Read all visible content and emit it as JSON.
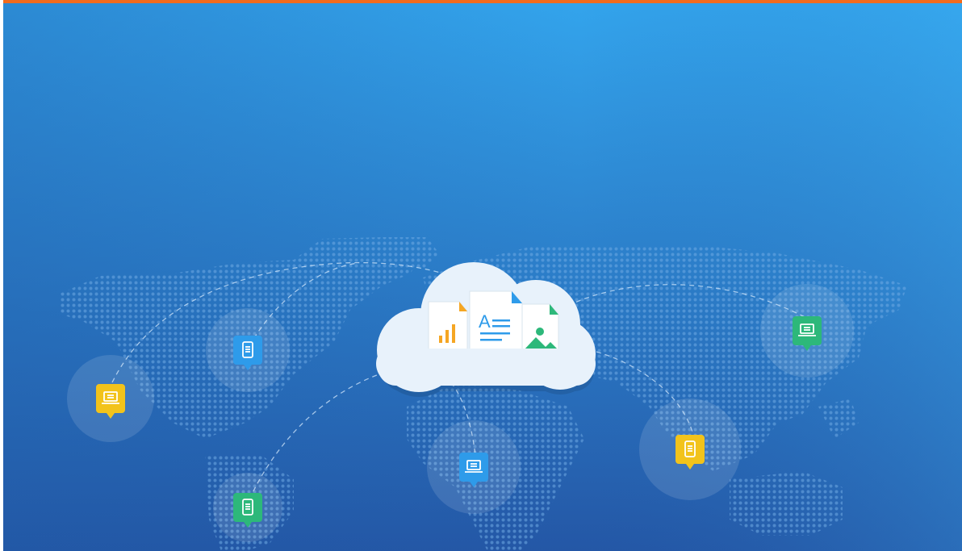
{
  "banner": {
    "accent_color": "#F26B1D",
    "gradient_top": "#33A4EC",
    "gradient_bottom": "#2457A6",
    "map_dot_color": "#6EA9E3",
    "cloud_color": "#E8F2FB",
    "cloud_files": [
      {
        "kind": "chart-file-icon",
        "accent": "#F5A623"
      },
      {
        "kind": "text-file-icon",
        "accent": "#2E9BEA"
      },
      {
        "kind": "image-file-icon",
        "accent": "#2DB87A"
      }
    ],
    "device_pins": [
      {
        "id": "pin-yellow-laptop-left",
        "device": "laptop-icon",
        "color": "#F2C31B"
      },
      {
        "id": "pin-blue-phone-left",
        "device": "phone-icon",
        "color": "#2E9BEA"
      },
      {
        "id": "pin-green-phone-bottom",
        "device": "phone-icon",
        "color": "#2DB87A"
      },
      {
        "id": "pin-blue-laptop-center",
        "device": "laptop-icon",
        "color": "#2E9BEA"
      },
      {
        "id": "pin-yellow-phone-right",
        "device": "phone-icon",
        "color": "#F2C31B"
      },
      {
        "id": "pin-green-laptop-right",
        "device": "laptop-icon",
        "color": "#2DB87A"
      }
    ]
  }
}
